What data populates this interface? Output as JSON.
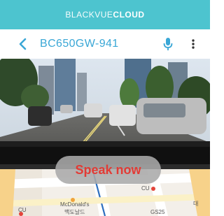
{
  "header": {
    "brand_light": "BLACKVUE",
    "brand_bold": "CLOUD",
    "bg_color": "#4dc4cf"
  },
  "device_bar": {
    "device_name": "BC650GW-941",
    "back_icon": "chevron-left-icon",
    "mic_icon": "microphone-icon",
    "more_icon": "more-vertical-icon",
    "accent_color": "#3aa7d6"
  },
  "video": {
    "content": "dashcam-live-view"
  },
  "voice": {
    "prompt": "Speak now",
    "text_color": "#e23b35"
  },
  "map": {
    "labels": [
      "CU",
      "McDonald's",
      "맥도날드",
      "CU",
      "GS25",
      "대"
    ]
  }
}
